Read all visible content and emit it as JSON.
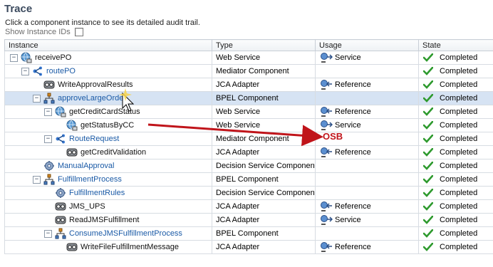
{
  "page": {
    "title": "Trace",
    "description": "Click a component instance to see its detailed audit trail.",
    "show_instance_ids_label": "Show Instance IDs"
  },
  "columns": {
    "instance": "Instance",
    "type": "Type",
    "usage": "Usage",
    "state": "State"
  },
  "rows": [
    {
      "indent": 0,
      "toggle": "−",
      "icon": "web-service-icon",
      "name": "receivePO",
      "link": false,
      "type": "Web Service",
      "usage": "Service",
      "usage_icon": "service-icon",
      "state": "Completed"
    },
    {
      "indent": 1,
      "toggle": "−",
      "icon": "mediator-icon",
      "name": "routePO",
      "link": true,
      "type": "Mediator Component",
      "usage": "",
      "usage_icon": "",
      "state": "Completed"
    },
    {
      "indent": 2,
      "toggle": "",
      "icon": "adapter-icon",
      "name": "WriteApprovalResults",
      "link": false,
      "type": "JCA Adapter",
      "usage": "Reference",
      "usage_icon": "reference-icon",
      "state": "Completed"
    },
    {
      "indent": 2,
      "toggle": "−",
      "icon": "bpel-icon",
      "name": "approveLargeOrder",
      "link": true,
      "type": "BPEL Component",
      "usage": "",
      "usage_icon": "",
      "state": "Completed",
      "selected": true
    },
    {
      "indent": 3,
      "toggle": "−",
      "icon": "web-service-icon",
      "name": "getCreditCardStatus",
      "link": false,
      "type": "Web Service",
      "usage": "Reference",
      "usage_icon": "reference-icon",
      "state": "Completed"
    },
    {
      "indent": 4,
      "toggle": "",
      "icon": "web-service-icon",
      "name": "getStatusByCC",
      "link": false,
      "type": "Web Service",
      "usage": "Service",
      "usage_icon": "service-icon",
      "state": "Completed"
    },
    {
      "indent": 3,
      "toggle": "−",
      "icon": "mediator-icon",
      "name": "RouteRequest",
      "link": true,
      "type": "Mediator Component",
      "usage": "",
      "usage_icon": "",
      "state": "Completed"
    },
    {
      "indent": 4,
      "toggle": "",
      "icon": "adapter-icon",
      "name": "getCreditValidation",
      "link": false,
      "type": "JCA Adapter",
      "usage": "Reference",
      "usage_icon": "reference-icon",
      "state": "Completed"
    },
    {
      "indent": 2,
      "toggle": "",
      "icon": "decision-service-icon",
      "name": "ManualApproval",
      "link": true,
      "type": "Decision Service Component",
      "usage": "",
      "usage_icon": "",
      "state": "Completed"
    },
    {
      "indent": 2,
      "toggle": "−",
      "icon": "bpel-icon",
      "name": "FulfillmentProcess",
      "link": true,
      "type": "BPEL Component",
      "usage": "",
      "usage_icon": "",
      "state": "Completed"
    },
    {
      "indent": 3,
      "toggle": "",
      "icon": "decision-service-icon",
      "name": "FulfillmentRules",
      "link": true,
      "type": "Decision Service Component",
      "usage": "",
      "usage_icon": "",
      "state": "Completed"
    },
    {
      "indent": 3,
      "toggle": "",
      "icon": "adapter-icon",
      "name": "JMS_UPS",
      "link": false,
      "type": "JCA Adapter",
      "usage": "Reference",
      "usage_icon": "reference-icon",
      "state": "Completed"
    },
    {
      "indent": 3,
      "toggle": "",
      "icon": "adapter-icon",
      "name": "ReadJMSFulfillment",
      "link": false,
      "type": "JCA Adapter",
      "usage": "Service",
      "usage_icon": "service-icon",
      "state": "Completed"
    },
    {
      "indent": 3,
      "toggle": "−",
      "icon": "bpel-icon",
      "name": "ConsumeJMSFulfillmentProcess",
      "link": true,
      "type": "BPEL Component",
      "usage": "",
      "usage_icon": "",
      "state": "Completed"
    },
    {
      "indent": 4,
      "toggle": "",
      "icon": "adapter-icon",
      "name": "WriteFileFulfillmentMessage",
      "link": false,
      "type": "JCA Adapter",
      "usage": "Reference",
      "usage_icon": "reference-icon",
      "state": "Completed"
    }
  ],
  "annotation": {
    "label": "OSB",
    "color": "#c0141a"
  },
  "colors": {
    "link": "#1a5aa6",
    "selected_row": "#d6e3f3",
    "check": "#2e9a2e"
  }
}
